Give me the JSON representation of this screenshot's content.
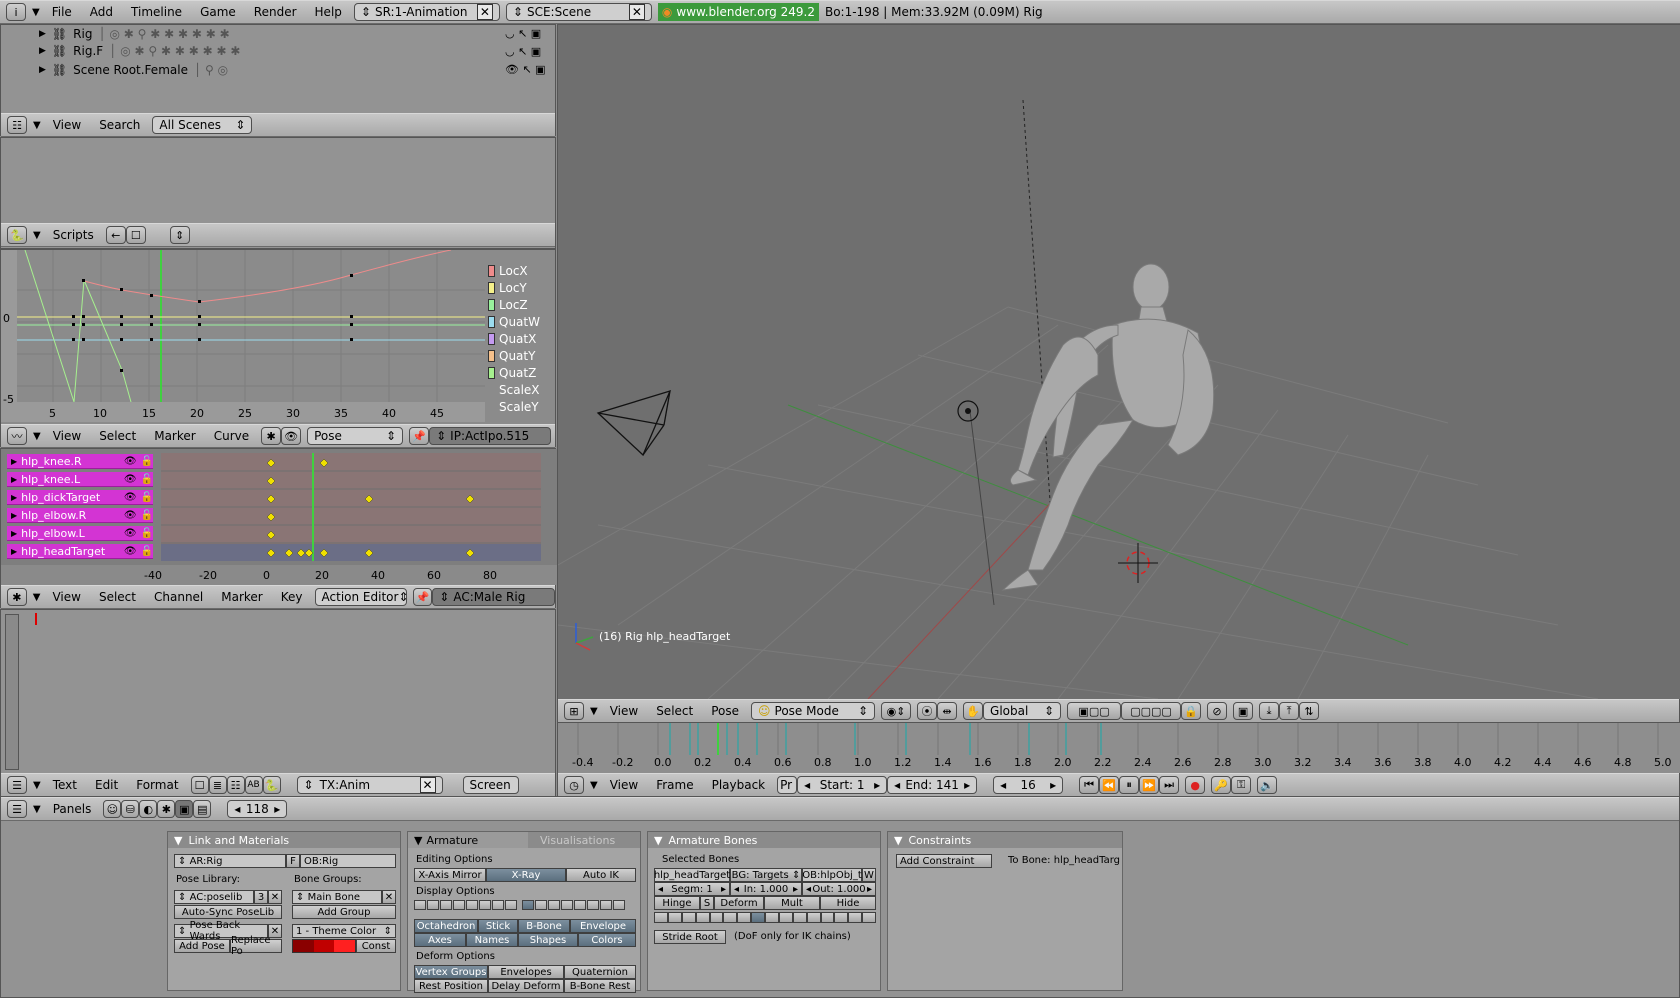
{
  "topbar": {
    "menus": [
      "File",
      "Add",
      "Timeline",
      "Game",
      "Render",
      "Help"
    ],
    "screen": "SR:1-Animation",
    "scene": "SCE:Scene",
    "version": "www.blender.org 249.2",
    "stats": "Bo:1-198  | Mem:33.92M (0.09M) Rig"
  },
  "outliner": {
    "rows": [
      "Rig",
      "Rig.F",
      "Scene Root.Female"
    ],
    "header": {
      "view": "View",
      "search": "Search",
      "scope": "All Scenes"
    }
  },
  "scripts_header": {
    "label": "Scripts"
  },
  "ipo": {
    "y_labels": [
      "0",
      "-5"
    ],
    "x_ticks": [
      "5",
      "10",
      "15",
      "20",
      "25",
      "30",
      "35",
      "40",
      "45"
    ],
    "channels": [
      {
        "name": "LocX",
        "color": "#ef8b8b"
      },
      {
        "name": "LocY",
        "color": "#f5f08a"
      },
      {
        "name": "LocZ",
        "color": "#98f09c"
      },
      {
        "name": "QuatW",
        "color": "#9bdcef"
      },
      {
        "name": "QuatX",
        "color": "#c49af0"
      },
      {
        "name": "QuatY",
        "color": "#f5c08b"
      },
      {
        "name": "QuatZ",
        "color": "#a6f08e"
      },
      {
        "name": "ScaleX",
        "color": ""
      },
      {
        "name": "ScaleY",
        "color": ""
      }
    ],
    "header": {
      "view": "View",
      "select": "Select",
      "marker": "Marker",
      "curve": "Curve",
      "mode": "Pose",
      "ipo": "IP:ActIpo.515"
    }
  },
  "action": {
    "channels": [
      "hlp_knee.R",
      "hlp_knee.L",
      "hlp_dickTarget",
      "hlp_elbow.R",
      "hlp_elbow.L",
      "hlp_headTarget"
    ],
    "x_ticks": [
      "-40",
      "-20",
      "0",
      "20",
      "40",
      "60",
      "80"
    ],
    "header": {
      "view": "View",
      "select": "Select",
      "channel": "Channel",
      "marker": "Marker",
      "key": "Key",
      "mode": "Action Editor",
      "action": "AC:Male Rig"
    }
  },
  "text_editor": {
    "header": {
      "text": "Text",
      "edit": "Edit",
      "format": "Format",
      "file": "TX:Anim",
      "screen": "Screen"
    }
  },
  "viewport": {
    "info": "(16) Rig hlp_headTarget",
    "header": {
      "view": "View",
      "select": "Select",
      "pose": "Pose",
      "mode": "Pose Mode",
      "orientation": "Global"
    }
  },
  "timeline": {
    "ticks": [
      "-0.4",
      "-0.2",
      "0.0",
      "0.2",
      "0.4",
      "0.6",
      "0.8",
      "1.0",
      "1.2",
      "1.4",
      "1.6",
      "1.8",
      "2.0",
      "2.2",
      "2.4",
      "2.6",
      "2.8",
      "3.0",
      "3.2",
      "3.4",
      "3.6",
      "3.8",
      "4.0",
      "4.2",
      "4.4",
      "4.6",
      "4.8",
      "5.0"
    ],
    "header": {
      "view": "View",
      "frame": "Frame",
      "playback": "Playback",
      "pr": "Pr",
      "start": "Start: 1",
      "end": "End: 141",
      "current": "16"
    }
  },
  "buttons": {
    "header": {
      "panels": "Panels",
      "frame": "118"
    },
    "link": {
      "title": "Link and Materials",
      "armature": "AR:Rig",
      "f": "F",
      "object": "OB:Rig",
      "pose_library": "Pose Library:",
      "bone_groups": "Bone Groups:",
      "poselib": "AC:poselib",
      "poselib_num": "3",
      "main_bone": "Main Bone",
      "auto_sync": "Auto-Sync PoseLib",
      "add_group": "Add Group",
      "pose_back": "Pose Back Wards",
      "theme": "1 - Theme Color",
      "add_pose": "Add Pose",
      "replace_pose": "Replace Po",
      "const": "Const"
    },
    "armature": {
      "tab1": "Armature",
      "tab2": "Visualisations",
      "editing": "Editing Options",
      "xmirror": "X-Axis Mirror",
      "xray": "X-Ray",
      "autoik": "Auto IK",
      "display": "Display Options",
      "octa": "Octahedron",
      "stick": "Stick",
      "bbone": "B-Bone",
      "envelope": "Envelope",
      "axes": "Axes",
      "names": "Names",
      "shapes": "Shapes",
      "colors": "Colors",
      "deform": "Deform Options",
      "vgroups": "Vertex Groups",
      "envelopes": "Envelopes",
      "quaternion": "Quaternion",
      "rest": "Rest Position",
      "delay": "Delay Deform",
      "bbrest": "B-Bone Rest"
    },
    "bones": {
      "title": "Armature Bones",
      "selected": "Selected Bones",
      "bone": "hlp_headTarget",
      "bg": "BG: Targets",
      "ob": "OB:hlpObj_t",
      "w": "W",
      "segm": "Segm: 1",
      "in": "In: 1.000",
      "out": "Out: 1.000",
      "hinge": "Hinge",
      "s": "S",
      "deform": "Deform",
      "mult": "Mult",
      "hide": "Hide",
      "stride": "Stride Root",
      "dof": "(DoF only for IK chains)"
    },
    "constraints": {
      "title": "Constraints",
      "add": "Add Constraint",
      "to_bone": "To Bone: hlp_headTarg"
    }
  }
}
